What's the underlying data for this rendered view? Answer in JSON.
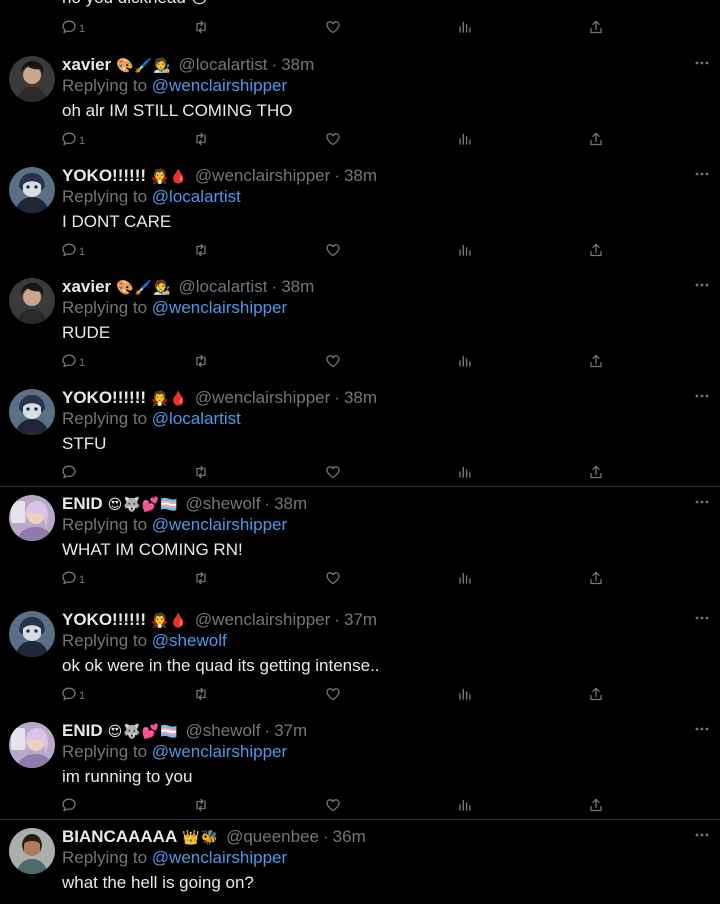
{
  "top_partial": {
    "text": "no you dickhead 😒",
    "reply_count": "1"
  },
  "tweets": [
    {
      "display_name": "xavier",
      "name_emoji": "🎨🖌️🧑‍🎨",
      "handle": "@localartist",
      "time": "38m",
      "reply_prefix": "Replying to",
      "reply_to": "@wenclairshipper",
      "text": "oh alr IM STILL COMING THO",
      "reply_count": "1",
      "avatar": "avatar-xavier"
    },
    {
      "display_name": "YOKO!!!!!!",
      "name_emoji": "🧛🩸",
      "handle": "@wenclairshipper",
      "time": "38m",
      "reply_prefix": "Replying to",
      "reply_to": "@localartist",
      "text": "I DONT CARE",
      "reply_count": "1",
      "avatar": "avatar-yoko"
    },
    {
      "display_name": "xavier",
      "name_emoji": "🎨🖌️🧑‍🎨",
      "handle": "@localartist",
      "time": "38m",
      "reply_prefix": "Replying to",
      "reply_to": "@wenclairshipper",
      "text": "RUDE",
      "reply_count": "1",
      "avatar": "avatar-xavier"
    },
    {
      "display_name": "YOKO!!!!!!",
      "name_emoji": "🧛🩸",
      "handle": "@wenclairshipper",
      "time": "38m",
      "reply_prefix": "Replying to",
      "reply_to": "@localartist",
      "text": "STFU",
      "reply_count": "",
      "avatar": "avatar-yoko"
    },
    {
      "display_name": "ENID",
      "name_emoji": "😍🐺💕🏳️‍⚧️",
      "handle": "@shewolf",
      "time": "38m",
      "reply_prefix": "Replying to",
      "reply_to": "@wenclairshipper",
      "text": "WHAT IM COMING RN!",
      "reply_count": "1",
      "avatar": "avatar-enid"
    },
    {
      "display_name": "YOKO!!!!!!",
      "name_emoji": "🧛🩸",
      "handle": "@wenclairshipper",
      "time": "37m",
      "reply_prefix": "Replying to",
      "reply_to": "@shewolf",
      "text": "ok ok were in the quad its getting intense..",
      "reply_count": "1",
      "avatar": "avatar-yoko"
    },
    {
      "display_name": "ENID",
      "name_emoji": "😍🐺💕🏳️‍⚧️",
      "handle": "@shewolf",
      "time": "37m",
      "reply_prefix": "Replying to",
      "reply_to": "@wenclairshipper",
      "text": "im running to you",
      "reply_count": "",
      "avatar": "avatar-enid"
    },
    {
      "display_name": "BIANCAAAAA",
      "name_emoji": "👑🐝",
      "handle": "@queenbee",
      "time": "36m",
      "reply_prefix": "Replying to",
      "reply_to": "@wenclairshipper",
      "text": "what the hell is going on?",
      "reply_count": "",
      "avatar": "avatar-bianca"
    }
  ],
  "colors": {
    "background": "#000000",
    "text": "#e7e9ea",
    "muted": "#71767b",
    "mention": "#4a99e9",
    "divider": "#2f3336"
  }
}
